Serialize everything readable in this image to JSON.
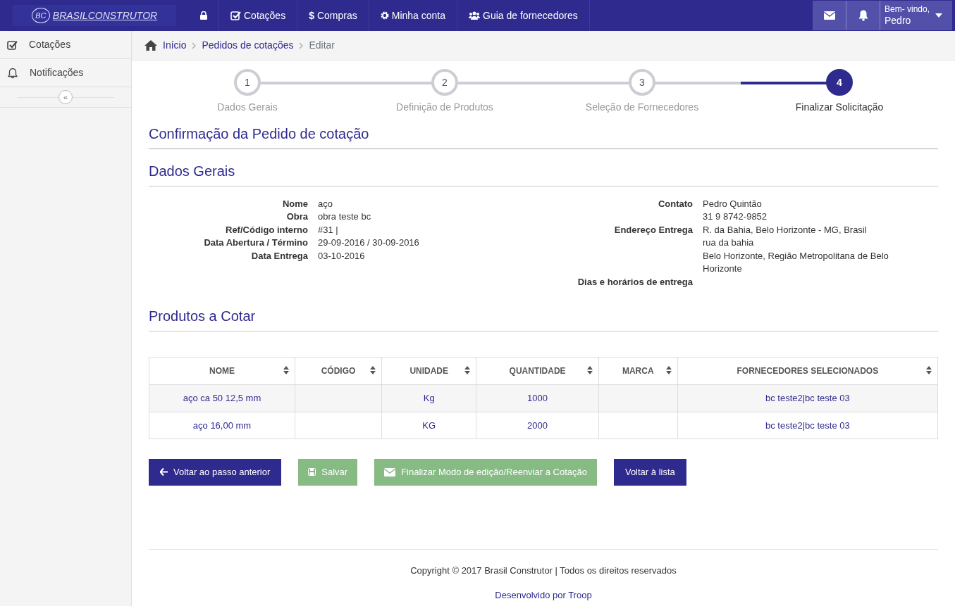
{
  "navbar": {
    "brand": "BRASILCONSTRUTOR",
    "brand_mark": "BC",
    "items": [
      {
        "kind": "lock"
      },
      {
        "kind": "check",
        "label": "Cotações"
      },
      {
        "kind": "dollar",
        "glyph": "$",
        "label": "Compras"
      },
      {
        "kind": "gear",
        "label": "Minha conta"
      },
      {
        "kind": "users",
        "label": "Guia de fornecedores"
      }
    ],
    "greeting": "Bem- vindo,",
    "user": "Pedro"
  },
  "sidebar": {
    "items": [
      {
        "kind": "check",
        "label": "Cotações"
      },
      {
        "kind": "bell",
        "label": "Notificações"
      }
    ],
    "collapse": "«"
  },
  "breadcrumb": [
    "Início",
    "Pedidos de cotações",
    "Editar"
  ],
  "steps": [
    {
      "number": "1",
      "label": "Dados Gerais",
      "selected": false
    },
    {
      "number": "2",
      "label": "Definição de Produtos",
      "selected": false
    },
    {
      "number": "3",
      "label": "Seleção de Fornecedores",
      "selected": false
    },
    {
      "number": "4",
      "label": "Finalizar Solicitação",
      "selected": true
    }
  ],
  "page_title": "Confirmação da Pedido de cotação",
  "general": {
    "title": "Dados Gerais",
    "left": [
      {
        "label": "Nome",
        "values": [
          "aço"
        ]
      },
      {
        "label": "Obra",
        "values": [
          "obra teste bc"
        ]
      },
      {
        "label": "Ref/Código interno",
        "values": [
          "#31 |"
        ]
      },
      {
        "label": "Data Abertura / Término",
        "values": [
          "29-09-2016 / 30-09-2016"
        ]
      },
      {
        "label": "Data Entrega",
        "values": [
          "03-10-2016"
        ]
      }
    ],
    "right": [
      {
        "label": "Contato",
        "values": [
          "Pedro Quintão",
          "31 9 8742-9852"
        ]
      },
      {
        "label": "Endereço Entrega",
        "values": [
          "R. da Bahia, Belo Horizonte - MG, Brasil",
          "rua da bahia",
          "Belo Horizonte, Região Metropolitana de Belo Horizonte"
        ]
      },
      {
        "label": "Dias e horários de entrega"
      }
    ]
  },
  "products": {
    "title": "Produtos a Cotar",
    "columns": [
      "NOME",
      "CÓDIGO",
      "UNIDADE",
      "QUANTIDADE",
      "MARCA",
      "FORNECEDORES SELECIONADOS"
    ],
    "rows": [
      [
        "aço ca 50 12,5 mm",
        "",
        "Kg",
        "1000",
        "",
        "bc teste2|bc teste 03"
      ],
      [
        "aço 16,00 mm",
        "",
        "KG",
        "2000",
        "",
        "bc teste2|bc teste 03"
      ]
    ]
  },
  "buttons": [
    {
      "kind": "back",
      "label": "Voltar ao passo anterior"
    },
    {
      "kind": "save",
      "label": "Salvar"
    },
    {
      "kind": "send",
      "label": "Finalizar Modo de edição/Reenviar a Cotação"
    },
    {
      "kind": "list",
      "label": "Voltar à lista"
    }
  ],
  "footer": {
    "copyright": "Copyright © 2017 Brasil Construtor | Todos os direitos reservados",
    "credit": "Desenvolvido por Troop"
  }
}
